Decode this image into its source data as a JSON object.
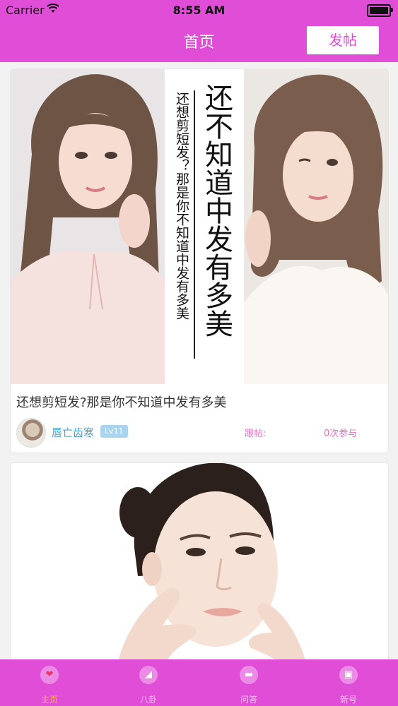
{
  "status_bar": {
    "carrier": "Carrier",
    "time": "8:55 AM"
  },
  "header": {
    "title": "首页",
    "post_button": "发帖"
  },
  "feed": {
    "posts": [
      {
        "image_caption_main": "还不知道中发有多美",
        "image_caption_side": "还想剪短发？那是你不知道中发有多美",
        "title": "还想剪短发?那是你不知道中发有多美",
        "author": "唇亡齿寒",
        "level": "Lv11",
        "reply_label": "跟帖:",
        "participation": "0次参与"
      }
    ]
  },
  "tabbar": {
    "items": [
      {
        "label": "主页",
        "icon": "heart-icon",
        "active": true
      },
      {
        "label": "八卦",
        "icon": "shoe-icon",
        "active": false
      },
      {
        "label": "问答",
        "icon": "chat-icon",
        "active": false
      },
      {
        "label": "新号",
        "icon": "badge-icon",
        "active": false
      }
    ]
  },
  "colors": {
    "accent": "#e04ed8",
    "link": "#47a6d6",
    "meta": "#e86cc4",
    "active_tab": "#ffb347"
  }
}
